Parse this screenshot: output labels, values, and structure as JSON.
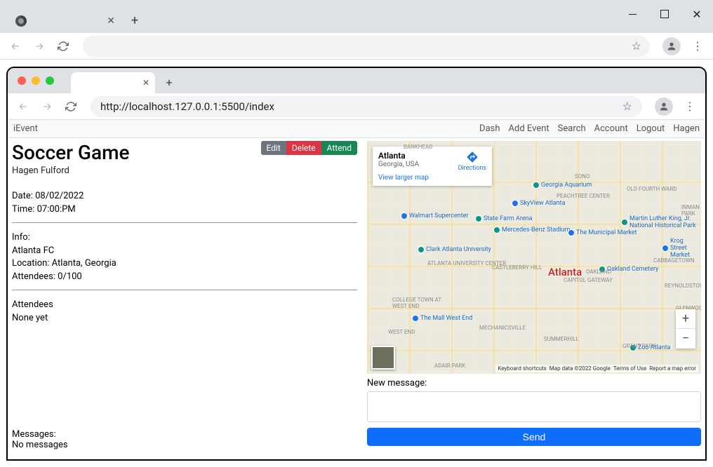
{
  "outer_browser": {
    "tab_close": "✕",
    "new_tab": "+"
  },
  "inner_browser": {
    "url": "http://localhost.127.0.0.1:5500/index",
    "tab_close": "✕",
    "new_tab": "+"
  },
  "nav": {
    "brand": "iEvent",
    "links": [
      "Dash",
      "Add Event",
      "Search",
      "Account",
      "Logout",
      "Hagen"
    ]
  },
  "event": {
    "title": "Soccer Game",
    "host": "Hagen Fulford",
    "date_label": "Date: 08/02/2022",
    "time_label": "Time: 07:00:PM",
    "info_label": "Info:",
    "info_text": "Atlanta FC",
    "location_label": "Location: Atlanta, Georgia",
    "attendees_label": "Attendees: 0/100",
    "attendees_header": "Attendees",
    "attendees_none": "None yet",
    "messages_header": "Messages:",
    "messages_none": "No messages"
  },
  "buttons": {
    "edit": "Edit",
    "delete": "Delete",
    "attend": "Attend",
    "send": "Send"
  },
  "map": {
    "card_title": "Atlanta",
    "card_sub": "Georgia, USA",
    "view_larger": "View larger map",
    "directions": "Directions",
    "center_label": "Atlanta",
    "attrib_shortcuts": "Keyboard shortcuts",
    "attrib_data": "Map data ©2022 Google",
    "attrib_terms": "Terms of Use",
    "attrib_report": "Report a map error",
    "poi": {
      "aquarium": "Georgia Aquarium",
      "skyview": "SkyView Atlanta",
      "walmart": "Walmart Supercenter",
      "statefarm": "State Farm Arena",
      "mbs": "Mercedes-Benz Stadium",
      "cau": "Clark Atlanta University",
      "mlk": "Martin Luther King, Jr. National Historical Park",
      "krog": "Krog Street Market",
      "municipal": "The Municipal Market",
      "zoo": "Zoo Atlanta",
      "auc": "ATLANTA UNIVERSITY CENTER",
      "castleberry": "CASTLEBERRY HILL",
      "mall": "The Mall West End",
      "mechanicsville": "MECHANICSVILLE",
      "summerhill": "SUMMERHILL",
      "grantpark": "GRANT PARK",
      "oakland": "OAKLAND",
      "cabbagetown": "CABBAGETOWN",
      "reynoldstown": "REYNOLDSTOWN",
      "glenwood": "GLENWOOD PARK",
      "peachtree": "PEACHTREE CENTER",
      "sono": "SONO",
      "oldfourth": "OLD FOURTH WARD",
      "inman": "INMAN PARK",
      "collegetown": "COLLEGE TOWN AT WEST END",
      "westend": "WEST END",
      "adair": "ADAIR PARK",
      "capgateway": "CAPITOL GATEWAY",
      "bankhead": "BANKHEAD",
      "oaklandcem": "Oakland Cemetery"
    }
  },
  "compose": {
    "label": "New message:"
  }
}
